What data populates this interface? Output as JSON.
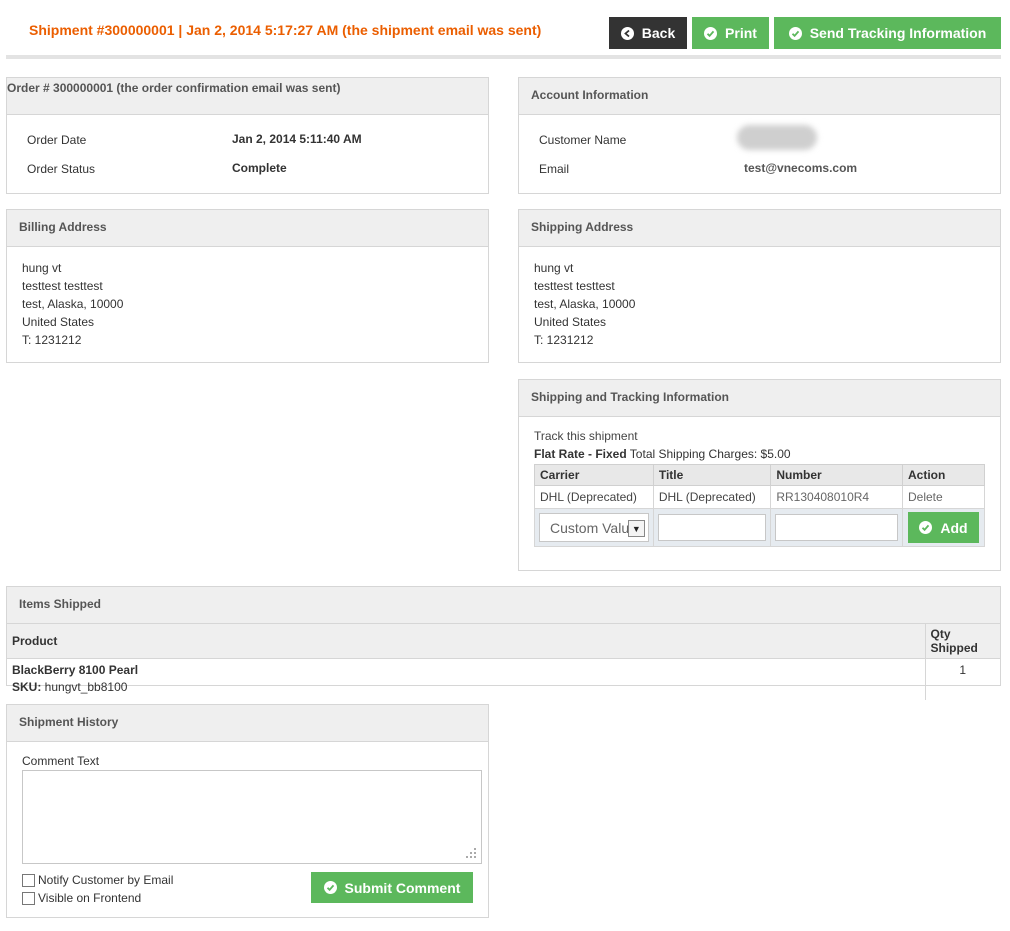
{
  "header": {
    "title": "Shipment #300000001 | Jan 2, 2014 5:17:27 AM (the shipment email was sent)",
    "back_label": "Back",
    "print_label": "Print",
    "send_tracking_label": "Send Tracking Information"
  },
  "order": {
    "heading": "Order # 300000001 (the order confirmation email was sent)",
    "date_label": "Order Date",
    "date_value": "Jan 2, 2014 5:11:40 AM",
    "status_label": "Order Status",
    "status_value": "Complete"
  },
  "account": {
    "heading": "Account Information",
    "name_label": "Customer Name",
    "email_label": "Email",
    "email_value": "test@vnecoms.com"
  },
  "billing": {
    "heading": "Billing Address",
    "lines": [
      "hung vt",
      "testtest testtest",
      "test, Alaska, 10000",
      "United States",
      "T: 1231212"
    ]
  },
  "shipping_address": {
    "heading": "Shipping Address",
    "lines": [
      "hung vt",
      "testtest testtest",
      "test, Alaska, 10000",
      "United States",
      "T: 1231212"
    ]
  },
  "tracking": {
    "heading": "Shipping and Tracking Information",
    "track_link": "Track this shipment",
    "method_bold": "Flat Rate - Fixed",
    "charges_text": " Total Shipping Charges: $5.00",
    "columns": [
      "Carrier",
      "Title",
      "Number",
      "Action"
    ],
    "row": {
      "carrier": "DHL (Deprecated)",
      "title": "DHL (Deprecated)",
      "number": "RR130408010R4",
      "action": "Delete"
    },
    "carrier_select_value": "Custom Value",
    "add_label": "Add"
  },
  "items": {
    "heading": "Items Shipped",
    "columns": [
      "Product",
      "Qty Shipped"
    ],
    "rows": [
      {
        "name": "BlackBerry 8100 Pearl",
        "sku_label": "SKU:",
        "sku": " hungvt_bb8100",
        "qty": "1"
      }
    ]
  },
  "history": {
    "heading": "Shipment History",
    "comment_label": "Comment Text",
    "notify_label": "Notify Customer by Email",
    "visible_label": "Visible on Frontend",
    "submit_label": "Submit Comment"
  },
  "colors": {
    "accent": "#eb5e00",
    "green": "#5cb85c",
    "dark": "#333333"
  }
}
